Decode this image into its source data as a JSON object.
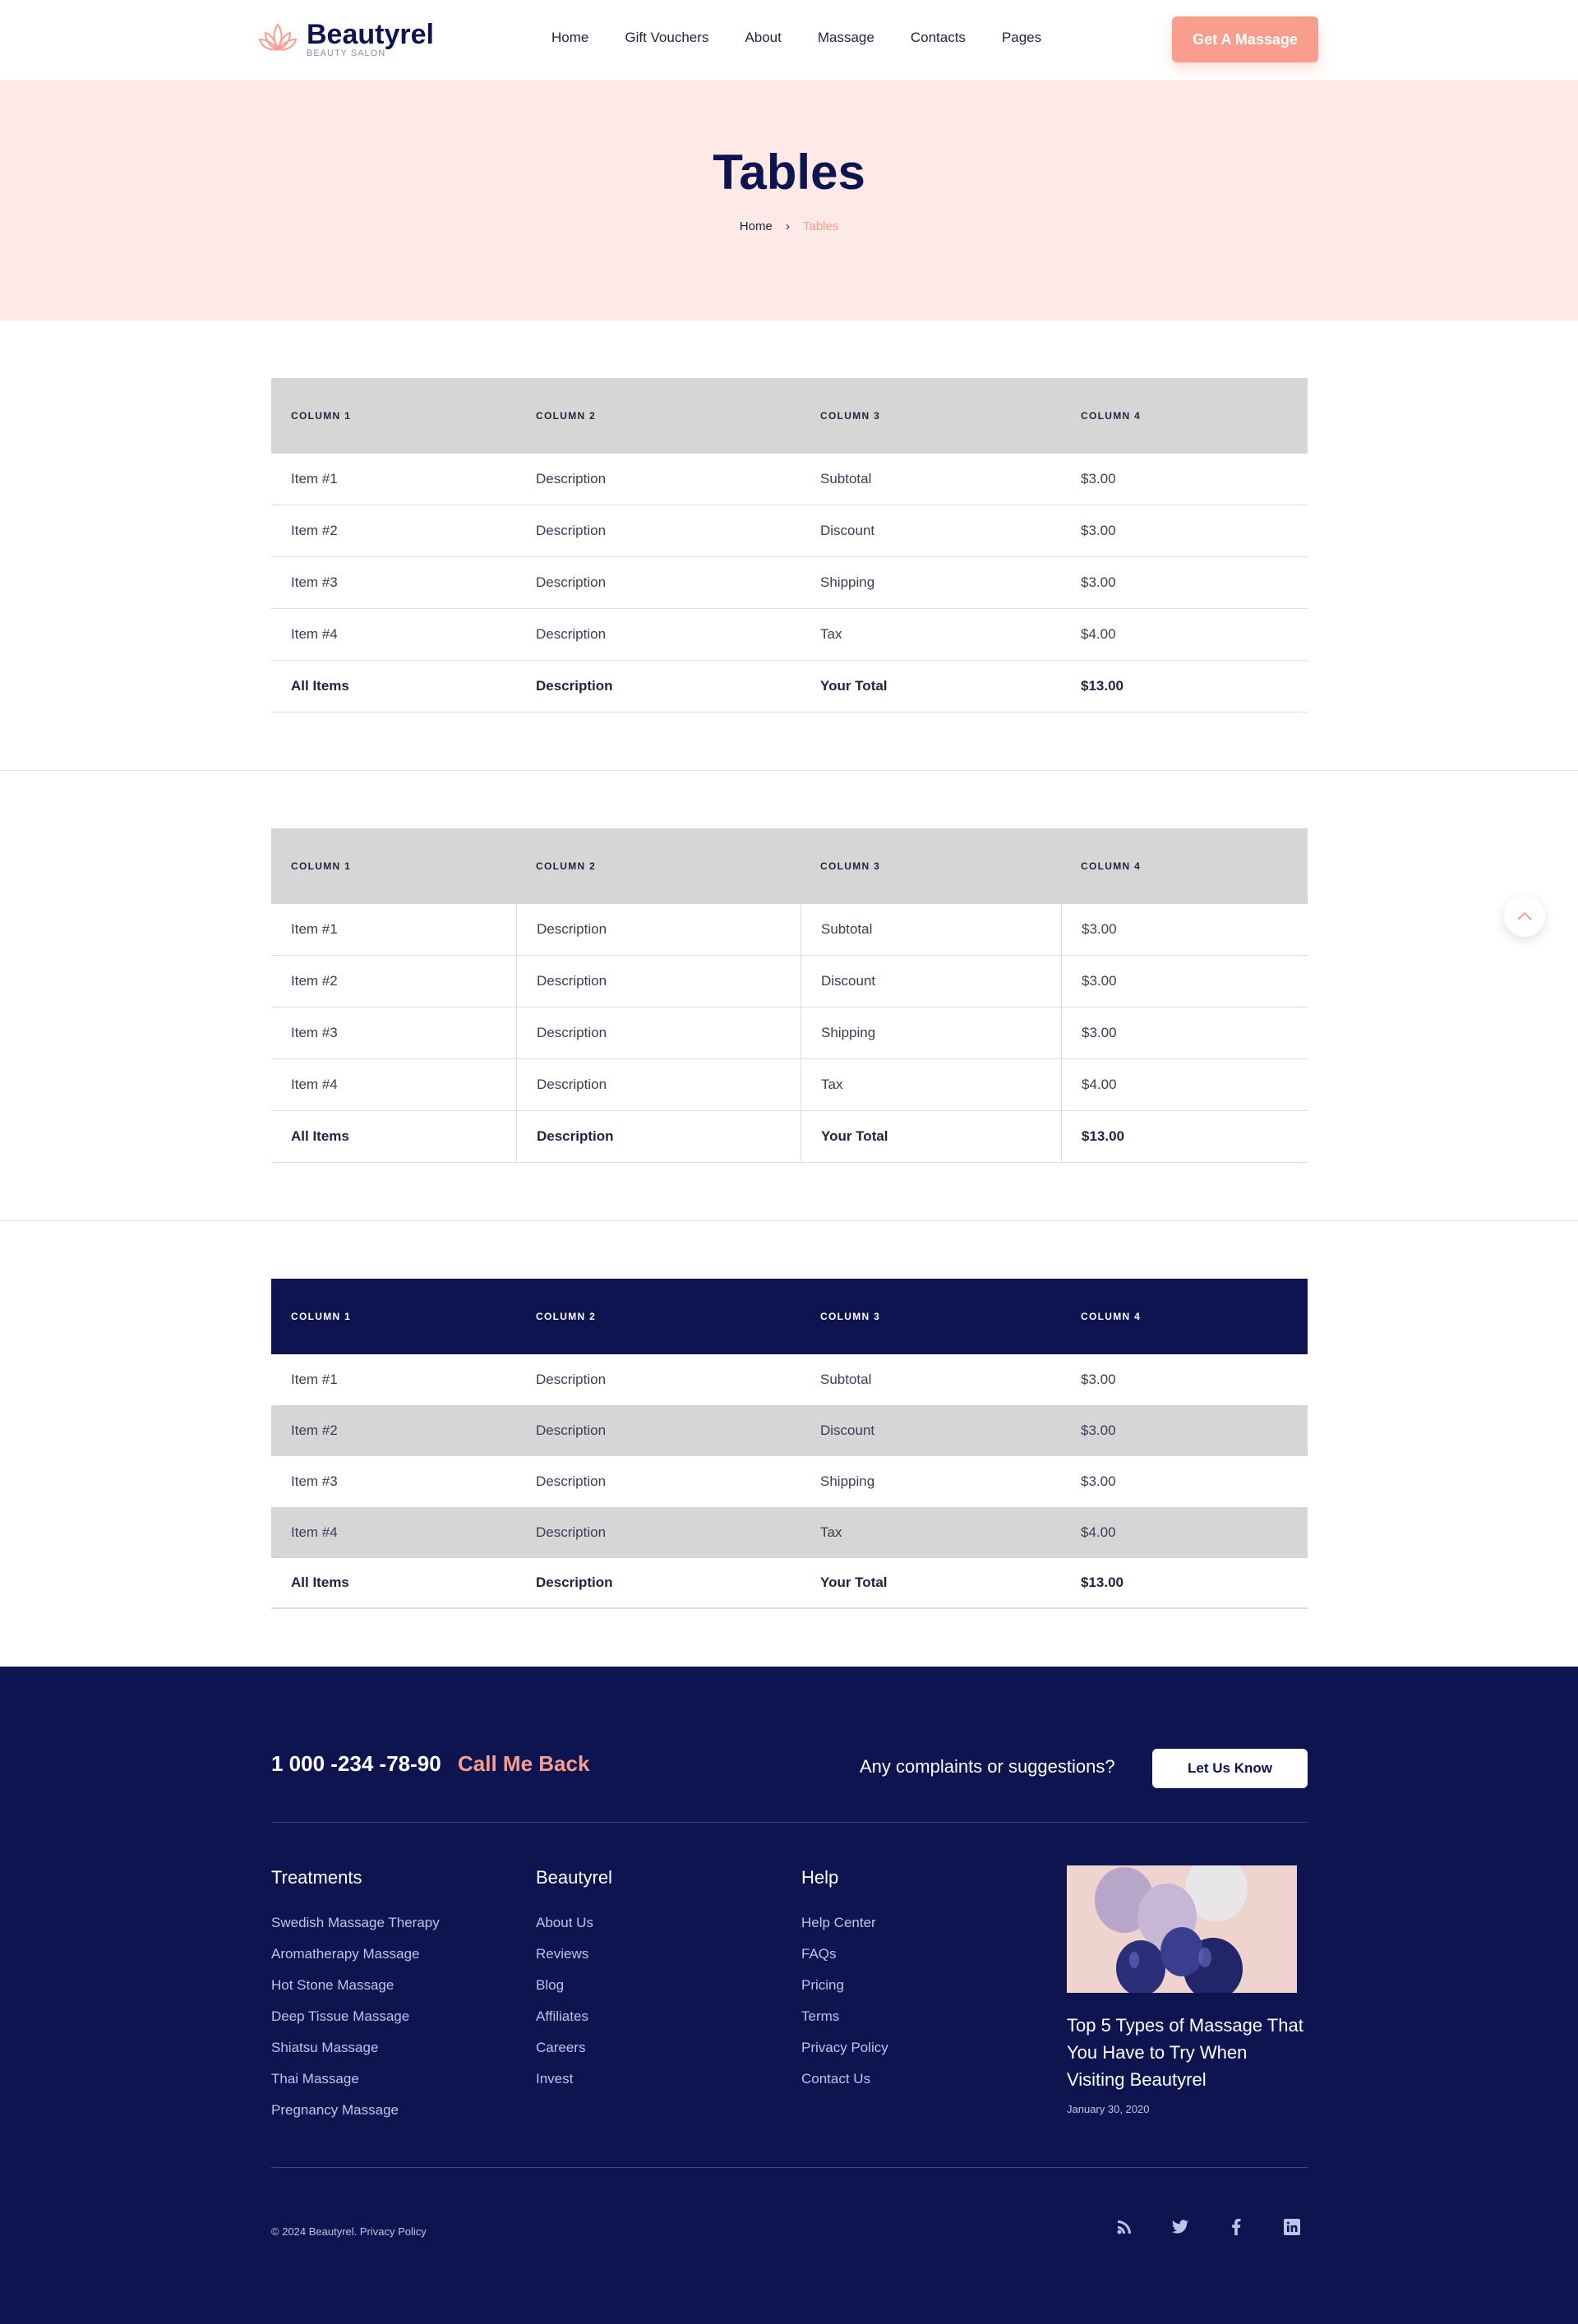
{
  "brand": {
    "name": "Beautyrel",
    "tagline": "BEAUTY SALON",
    "accent": "#f99d8f",
    "navy": "#0e1450"
  },
  "nav": [
    {
      "label": "Home"
    },
    {
      "label": "Gift Vouchers"
    },
    {
      "label": "About"
    },
    {
      "label": "Massage"
    },
    {
      "label": "Contacts"
    },
    {
      "label": "Pages"
    }
  ],
  "header_cta": "Get A Massage",
  "hero": {
    "title": "Tables",
    "crumb_home": "Home",
    "crumb_current": "Tables"
  },
  "table": {
    "columns": [
      "COLUMN 1",
      "COLUMN 2",
      "COLUMN 3",
      "COLUMN 4"
    ],
    "rows": [
      [
        "Item #1",
        "Description",
        "Subtotal",
        "$3.00"
      ],
      [
        "Item #2",
        "Description",
        "Discount",
        "$3.00"
      ],
      [
        "Item #3",
        "Description",
        "Shipping",
        "$3.00"
      ],
      [
        "Item #4",
        "Description",
        "Tax",
        "$4.00"
      ]
    ],
    "total": [
      "All Items",
      "Description",
      "Your Total",
      "$13.00"
    ]
  },
  "scroll_top_icon": "chevron-up-icon",
  "footer": {
    "phone": "1 000 -234 -78-90",
    "callback": "Call Me Back",
    "complaints": "Any complaints or suggestions?",
    "let_us_know": "Let Us Know",
    "columns": [
      {
        "title": "Treatments",
        "links": [
          "Swedish Massage Therapy",
          "Aromatherapy Massage",
          "Hot Stone Massage",
          "Deep Tissue Massage",
          "Shiatsu Massage",
          "Thai Massage",
          "Pregnancy Massage"
        ]
      },
      {
        "title": "Beautyrel",
        "links": [
          "About Us",
          "Reviews",
          "Blog",
          "Affiliates",
          "Careers",
          "Invest"
        ]
      },
      {
        "title": "Help",
        "links": [
          "Help Center",
          "FAQs",
          "Pricing",
          "Terms",
          "Privacy Policy",
          "Contact Us"
        ]
      }
    ],
    "post": {
      "title": "Top 5 Types of Massage That You Have to Try When Visiting Beautyrel",
      "date": "January 30, 2020"
    },
    "copyright": "© 2024 Beautyrel. Privacy Policy",
    "socials": [
      "rss-icon",
      "twitter-icon",
      "facebook-icon",
      "linkedin-icon"
    ]
  }
}
